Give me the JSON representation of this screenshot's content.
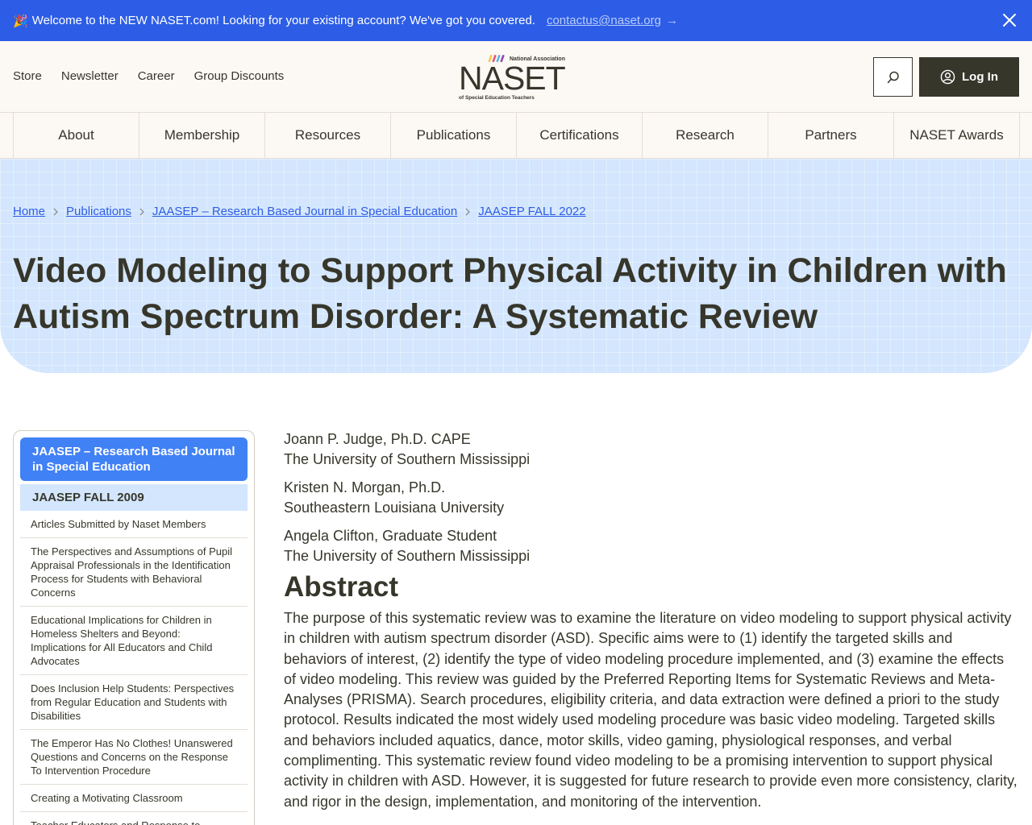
{
  "banner": {
    "emoji": "🎉",
    "message": "Welcome to the NEW NASET.com! Looking for your existing account? We've got you covered.",
    "email": "contactus@naset.org",
    "arrow": "→"
  },
  "utility_nav": [
    "Store",
    "Newsletter",
    "Career",
    "Group Discounts"
  ],
  "logo": {
    "top_line": "National Association",
    "wordmark": "NASET",
    "bottom_line": "of Special Education Teachers"
  },
  "header": {
    "login_label": "Log In"
  },
  "main_nav": [
    "About",
    "Membership",
    "Resources",
    "Publications",
    "Certifications",
    "Research",
    "Partners",
    "NASET Awards"
  ],
  "breadcrumbs": [
    "Home",
    "Publications",
    "JAASEP – Research Based Journal in Special Education",
    "JAASEP FALL 2022"
  ],
  "page_title": "Video Modeling to Support Physical Activity in Children with Autism Spectrum Disorder: A Systematic Review",
  "sidebar": {
    "active": "JAASEP – Research Based Journal in Special Education",
    "sub": "JAASEP FALL 2009",
    "items": [
      "Articles Submitted by Naset Members",
      "The Perspectives and Assumptions of Pupil Appraisal Professionals in the Identification Process for Students with Behavioral Concerns",
      "Educational Implications for Children in Homeless Shelters and Beyond: Implications for All Educators and Child Advocates",
      "Does Inclusion Help Students: Perspectives from Regular Education and Students with Disabilities",
      "The Emperor Has No Clothes! Unanswered Questions and Concerns on the Response To Intervention Procedure",
      "Creating a Motivating Classroom",
      "Teacher Educators and Response to Intervention: A Survey of Knowledge"
    ]
  },
  "authors": [
    {
      "name": "Joann P. Judge, Ph.D. CAPE",
      "affiliation": "The University of Southern Mississippi"
    },
    {
      "name": "Kristen N. Morgan, Ph.D.",
      "affiliation": "Southeastern Louisiana University"
    },
    {
      "name": "Angela Clifton, Graduate Student",
      "affiliation": "The University of Southern Mississippi"
    }
  ],
  "abstract": {
    "heading": "Abstract",
    "text": "The purpose of this systematic review was to examine the literature on video modeling to support physical activity in children with autism spectrum disorder (ASD). Specific aims were to (1) identify the targeted skills and behaviors of interest, (2) identify the type of video modeling procedure implemented, and (3) examine the effects of video modeling. This review was guided by the Preferred Reporting Items for Systematic Reviews and Meta-Analyses (PRISMA). Search procedures, eligibility criteria, and data extraction were defined a priori to the study protocol. Results indicated the most widely used modeling procedure was basic video modeling. Targeted skills and behaviors included aquatics, dance, motor skills, video gaming, physiological responses, and verbal complimenting. This systematic review found video modeling to be a promising intervention to support physical activity in children with ASD. However, it is suggested for future research to  provide even more consistency, clarity, and rigor in the design, implementation, and monitoring of the intervention."
  },
  "colors": {
    "banner_bg": "#2d5de6",
    "text_dark": "#37362b",
    "hero_bg": "#d3e6fd",
    "sidebar_active": "#4181f6",
    "link": "#2d5de6"
  },
  "icons": [
    "party-icon",
    "arrow-right-icon",
    "close-icon",
    "search-icon",
    "user-icon",
    "chevron-right-icon"
  ]
}
